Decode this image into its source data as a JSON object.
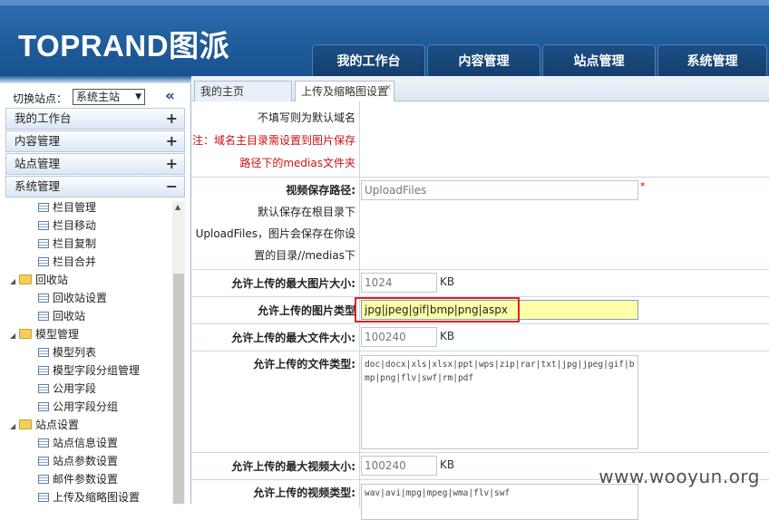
{
  "header": {
    "logo": "TOPRAND图派",
    "nav": [
      "我的工作台",
      "内容管理",
      "站点管理",
      "系统管理"
    ]
  },
  "sidebar": {
    "switch_label": "切换站点：",
    "switch_value": "系统主站",
    "collapse": "«",
    "menus": [
      {
        "label": "我的工作台",
        "toggle": "+"
      },
      {
        "label": "内容管理",
        "toggle": "+"
      },
      {
        "label": "站点管理",
        "toggle": "+"
      },
      {
        "label": "系统管理",
        "toggle": "−"
      }
    ],
    "tree": [
      {
        "label": "栏目管理",
        "type": "doc"
      },
      {
        "label": "栏目移动",
        "type": "doc"
      },
      {
        "label": "栏目复制",
        "type": "doc"
      },
      {
        "label": "栏目合并",
        "type": "doc"
      },
      {
        "label": "回收站",
        "type": "folder"
      },
      {
        "label": "回收站设置",
        "type": "doc"
      },
      {
        "label": "回收站",
        "type": "doc"
      },
      {
        "label": "模型管理",
        "type": "folder"
      },
      {
        "label": "模型列表",
        "type": "doc"
      },
      {
        "label": "模型字段分组管理",
        "type": "doc"
      },
      {
        "label": "公用字段",
        "type": "doc"
      },
      {
        "label": "公用字段分组",
        "type": "doc"
      },
      {
        "label": "站点设置",
        "type": "folder"
      },
      {
        "label": "站点信息设置",
        "type": "doc"
      },
      {
        "label": "站点参数设置",
        "type": "doc"
      },
      {
        "label": "邮件参数设置",
        "type": "doc"
      },
      {
        "label": "上传及缩略图设置",
        "type": "doc"
      }
    ]
  },
  "tabs": [
    {
      "label": "我的主页"
    },
    {
      "label": "上传及缩略图设置",
      "close": "×"
    }
  ],
  "form": {
    "note1": "不填写则为默认域名",
    "note2": "注：域名主目录需设置到图片保存",
    "note3": "路径下的medias文件夹",
    "video_path_label": "视频保存路径:",
    "video_path_value": "UploadFiles",
    "video_note1": "默认保存在根目录下",
    "video_note2": "UploadFiles，图片会保存在你设",
    "video_note3": "置的目录//medias下",
    "req": "*",
    "max_image_label": "允许上传的最大图片大小:",
    "max_image_value": "1024",
    "unit_kb": "KB",
    "image_types_label": "允许上传的图片类型",
    "image_types_value": "jpg|jpeg|gif|bmp|png|aspx",
    "max_file_label": "允许上传的最大文件大小:",
    "max_file_value": "100240",
    "file_types_label": "允许上传的文件类型:",
    "file_types_value": "doc|docx|xls|xlsx|ppt|wps|zip|rar|txt|jpg|jpeg|gif|bmp|png|flv|swf|rm|pdf",
    "max_video_label": "允许上传的最大视频大小:",
    "max_video_value": "100240",
    "video_types_label": "允许上传的视频类型:",
    "video_types_value": "wav|avi|mpg|mpeg|wma|flv|swf"
  },
  "watermark": "www.wooyun.org"
}
